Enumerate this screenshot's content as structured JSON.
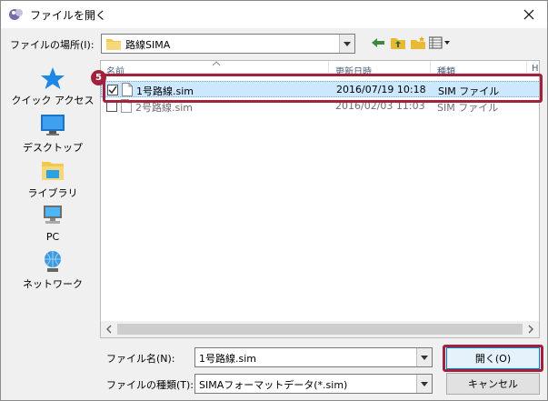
{
  "window": {
    "title": "ファイルを開く",
    "accent_color": "#a0223c",
    "select_color": "#cce8ff"
  },
  "location": {
    "label": "ファイルの場所(I):",
    "value": "路線SIMA"
  },
  "places": [
    {
      "label": "クイック アクセス",
      "icon": "quick-access-star-icon"
    },
    {
      "label": "デスクトップ",
      "icon": "desktop-icon"
    },
    {
      "label": "ライブラリ",
      "icon": "library-icon"
    },
    {
      "label": "PC",
      "icon": "pc-icon"
    },
    {
      "label": "ネットワーク",
      "icon": "network-icon"
    }
  ],
  "list": {
    "columns": [
      "名前",
      "更新日時",
      "種類",
      "H"
    ],
    "rows": [
      {
        "name": "1号路線.sim",
        "date": "2016/07/19 10:18",
        "type": "SIM ファイル",
        "checked": true,
        "selected": true
      },
      {
        "name": "2号路線.sim",
        "date": "2016/02/03 11:03",
        "type": "SIM ファイル",
        "checked": false,
        "selected": false
      }
    ]
  },
  "callout_badge": "5",
  "filename": {
    "label": "ファイル名(N):",
    "value": "1号路線.sim"
  },
  "filetype": {
    "label": "ファイルの種類(T):",
    "value": "SIMAフォーマットデータ(*.sim)"
  },
  "buttons": {
    "open": "開く(O)",
    "cancel": "キャンセル"
  }
}
